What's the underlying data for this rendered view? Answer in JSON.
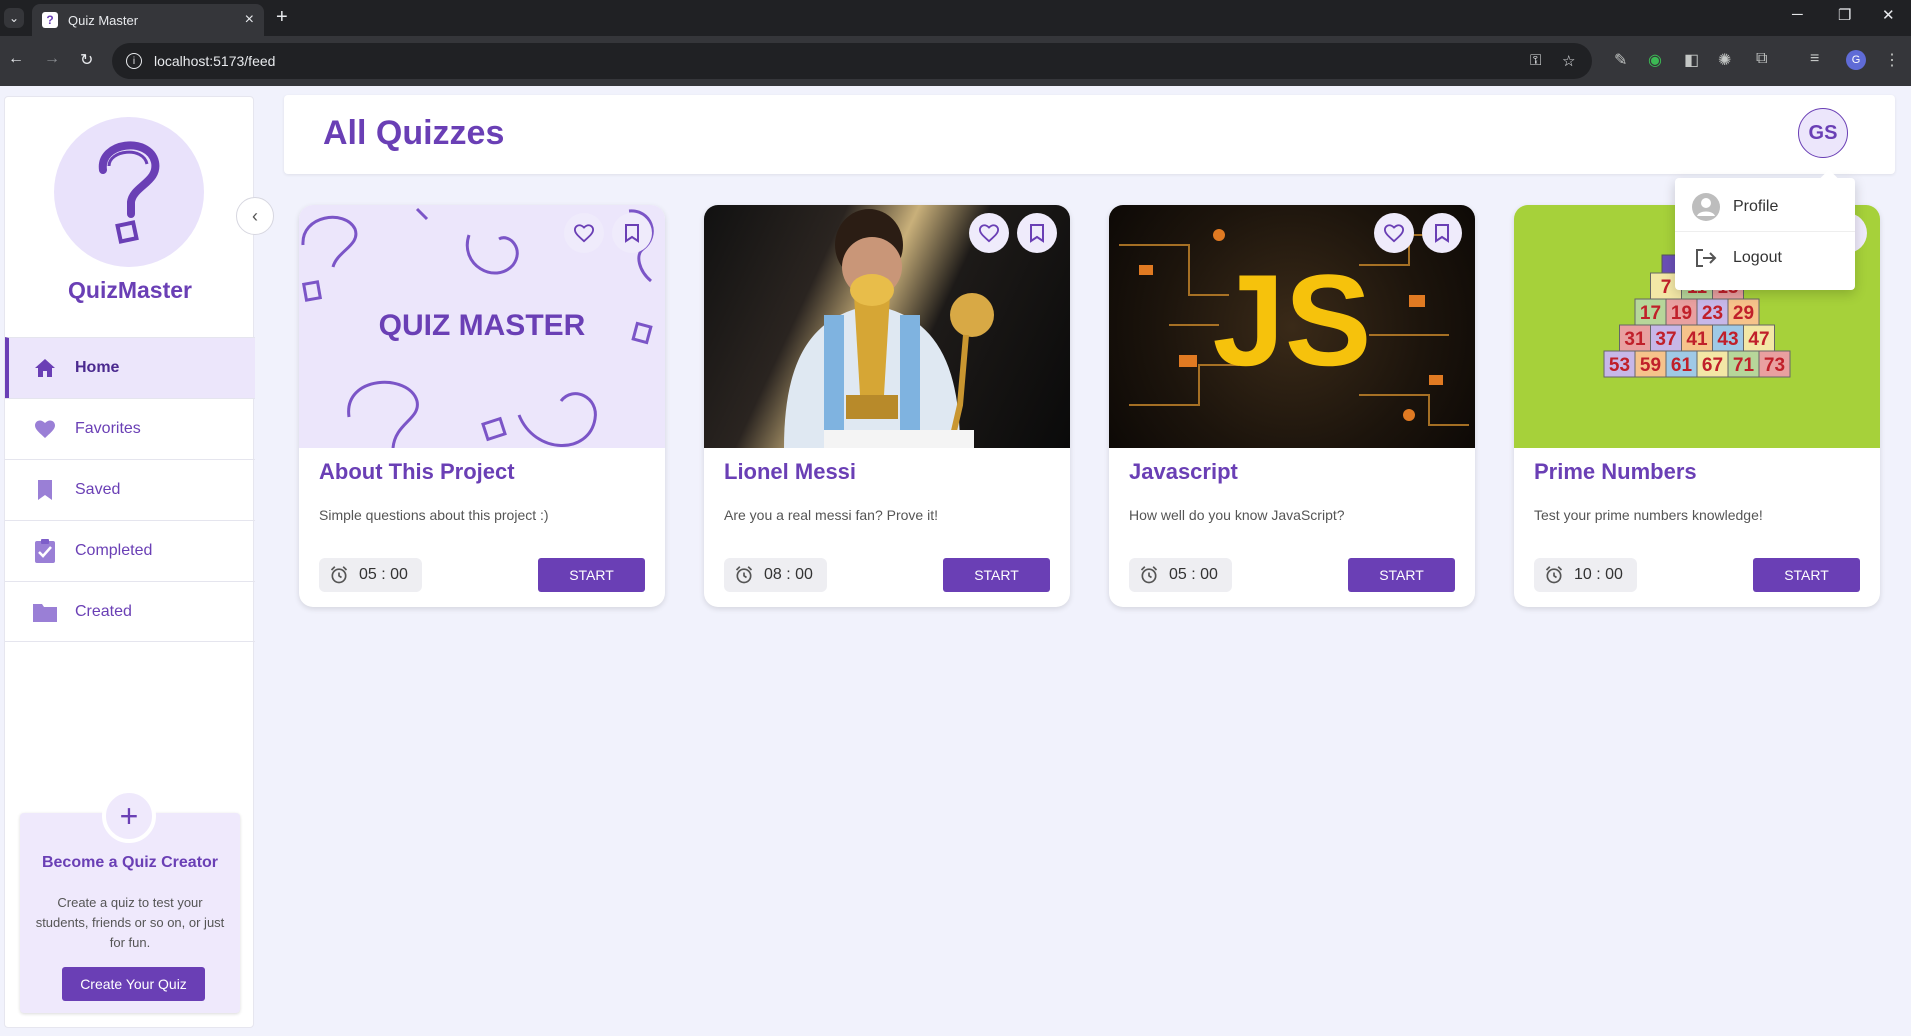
{
  "browser": {
    "tab_title": "Quiz Master",
    "url": "localhost:5173/feed",
    "profile_initial": "G"
  },
  "sidebar": {
    "brand": "QuizMaster",
    "items": [
      {
        "label": "Home",
        "icon": "home-icon",
        "active": true
      },
      {
        "label": "Favorites",
        "icon": "heart-icon"
      },
      {
        "label": "Saved",
        "icon": "bookmark-icon"
      },
      {
        "label": "Completed",
        "icon": "assignment-check-icon"
      },
      {
        "label": "Created",
        "icon": "folder-icon"
      }
    ],
    "creator": {
      "title": "Become a Quiz Creator",
      "text": "Create a quiz to test your students, friends or so on, or just for fun.",
      "button": "Create Your Quiz"
    }
  },
  "header": {
    "title": "All Quizzes",
    "avatar": "GS"
  },
  "menu": {
    "items": [
      {
        "label": "Profile",
        "icon": "account-circle-icon"
      },
      {
        "label": "Logout",
        "icon": "logout-icon"
      }
    ]
  },
  "quizzes": [
    {
      "title": "About This Project",
      "description": "Simple questions about this project :)",
      "time": "05 : 00",
      "button": "START",
      "image_text": "QUIZ MASTER"
    },
    {
      "title": "Lionel Messi",
      "description": "Are you a real messi fan? Prove it!",
      "time": "08 : 00",
      "button": "START"
    },
    {
      "title": "Javascript",
      "description": "How well do you know JavaScript?",
      "time": "05 : 00",
      "button": "START",
      "image_text": "JS"
    },
    {
      "title": "Prime Numbers",
      "description": "Test your prime numbers knowledge!",
      "time": "10 : 00",
      "button": "START",
      "image_numbers": [
        "7",
        "11",
        "13",
        "17",
        "19",
        "23",
        "29",
        "31",
        "37",
        "41",
        "43",
        "47",
        "53",
        "59",
        "61",
        "67",
        "71",
        "73"
      ]
    }
  ],
  "colors": {
    "primary": "#6a3fb5",
    "background": "#f1f2fc",
    "accent_light": "#ece6fb"
  }
}
